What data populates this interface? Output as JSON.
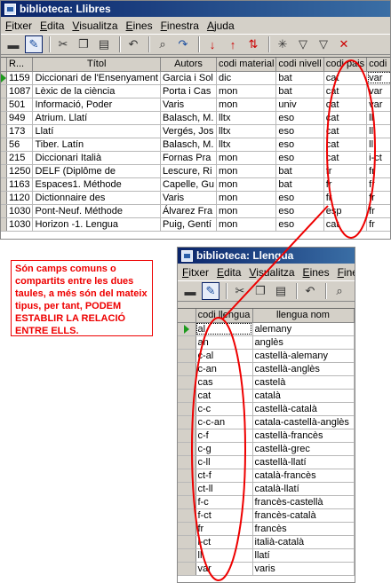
{
  "window_libres": {
    "title": "biblioteca: Llibres",
    "menu": [
      "Fitxer",
      "Edita",
      "Visualitza",
      "Eines",
      "Finestra",
      "Ajuda"
    ],
    "columns": [
      "R...",
      "Títol",
      "Autors",
      "codi material",
      "codi nivell",
      "codi pais",
      "codi llengua"
    ],
    "rows": [
      [
        "1159",
        "Diccionari de l'Ensenyament",
        "Garcia i Sol",
        "dic",
        "bat",
        "cat",
        "var"
      ],
      [
        "1087",
        "Lèxic de la ciència",
        "Porta i Cas",
        "mon",
        "bat",
        "cat",
        "var"
      ],
      [
        "501",
        "Informació, Poder",
        "Varis",
        "mon",
        "univ",
        "cat",
        "var"
      ],
      [
        "949",
        "Atrium. Llatí",
        "Balasch, M.",
        "lltx",
        "eso",
        "cat",
        "ll"
      ],
      [
        "173",
        "Llatí",
        "Vergés, Jos",
        "lltx",
        "eso",
        "cat",
        "ll"
      ],
      [
        "56",
        "Tiber. Latín",
        "Balasch, M.",
        "lltx",
        "eso",
        "cat",
        "ll"
      ],
      [
        "215",
        "Diccionari Italià",
        "Fornas Pra",
        "mon",
        "eso",
        "cat",
        "i-ct"
      ],
      [
        "1250",
        "DELF (Diplôme de",
        "Lescure, Ri",
        "mon",
        "bat",
        "fr",
        "fr"
      ],
      [
        "1163",
        "Espaces1. Méthode",
        "Capelle, Gu",
        "mon",
        "bat",
        "fr",
        "fr"
      ],
      [
        "1120",
        "Dictionnaire des",
        "Varis",
        "mon",
        "eso",
        "fr",
        "fr"
      ],
      [
        "1030",
        "Pont-Neuf. Méthode",
        "Álvarez Fra",
        "mon",
        "eso",
        "esp",
        "fr"
      ],
      [
        "1030",
        "Horizon -1. Lengua",
        "Puig, Gentí",
        "mon",
        "eso",
        "cat",
        "fr"
      ]
    ]
  },
  "window_llengua": {
    "title": "biblioteca: Llengua",
    "menu": [
      "Fitxer",
      "Edita",
      "Visualitza",
      "Eines",
      "Finestra"
    ],
    "columns": [
      "codi llengua",
      "llengua nom"
    ],
    "rows": [
      [
        "al",
        "alemany"
      ],
      [
        "an",
        "anglès"
      ],
      [
        "c-al",
        "castellà-alemany"
      ],
      [
        "c-an",
        "castellà-anglès"
      ],
      [
        "cas",
        "castelà"
      ],
      [
        "cat",
        "català"
      ],
      [
        "c-c",
        "castellà-català"
      ],
      [
        "c-c-an",
        "catala-castellà-anglès"
      ],
      [
        "c-f",
        "castellà-francès"
      ],
      [
        "c-g",
        "castellà-grec"
      ],
      [
        "c-ll",
        "castellà-llatí"
      ],
      [
        "ct-f",
        "català-francès"
      ],
      [
        "ct-ll",
        "català-llatí"
      ],
      [
        "f-c",
        "francès-castellà"
      ],
      [
        "f-ct",
        "francès-català"
      ],
      [
        "fr",
        "francès"
      ],
      [
        "i-ct",
        "italià-català"
      ],
      [
        "ll",
        "llatí"
      ],
      [
        "var",
        "varis"
      ]
    ]
  },
  "annotation": {
    "text": "Són camps comuns o compartits entre les dues taules, a més són del mateix tipus, per tant, PODEM ESTABLIR LA RELACIÓ ENTRE ELLS."
  },
  "colors": {
    "annotation": "#e00000",
    "titlebar": "#0a246a",
    "record_indicator": "#1c9a1c"
  },
  "icons": [
    "save-icon",
    "edit-icon",
    "cut-icon",
    "copy-icon",
    "paste-icon",
    "undo-icon",
    "find-icon",
    "redo-icon",
    "sort-asc-icon",
    "sort-desc-icon",
    "sort-icon",
    "autofilter-icon",
    "filter-icon",
    "standard-filter-icon",
    "remove-filter-icon"
  ]
}
